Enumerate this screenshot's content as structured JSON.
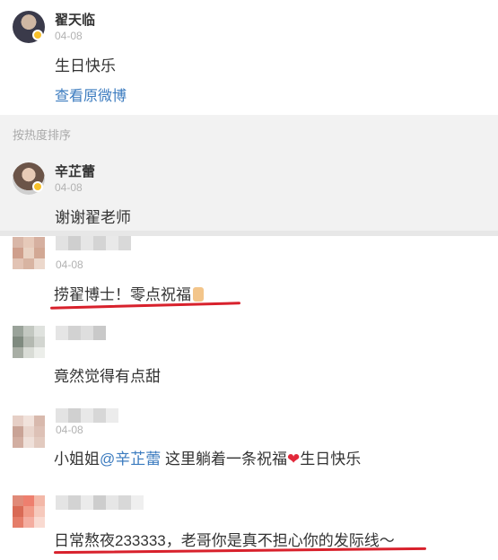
{
  "post": {
    "username": "翟天临",
    "date": "04-08",
    "content": "生日快乐",
    "view_original": "查看原微博"
  },
  "sort_label": "按热度排序",
  "reply": {
    "username": "辛芷蕾",
    "date": "04-08",
    "content": "谢谢翟老师"
  },
  "comments": [
    {
      "date": "04-08",
      "content": "捞翟博士！零点祝福"
    },
    {
      "date": "",
      "content": "竟然觉得有点甜"
    },
    {
      "date": "04-08",
      "content_pre": "小姐姐",
      "mention": "@辛芷蕾",
      "content_mid": " 这里躺着一条祝福",
      "heart": "❤",
      "content_post": "生日快乐"
    },
    {
      "date": "",
      "content": "日常熬夜233333，老哥你是真不担心你的发际线～"
    }
  ],
  "colors": {
    "link": "#3b7bbf",
    "badge": "#f7c02a",
    "annotation": "#d8212c"
  }
}
